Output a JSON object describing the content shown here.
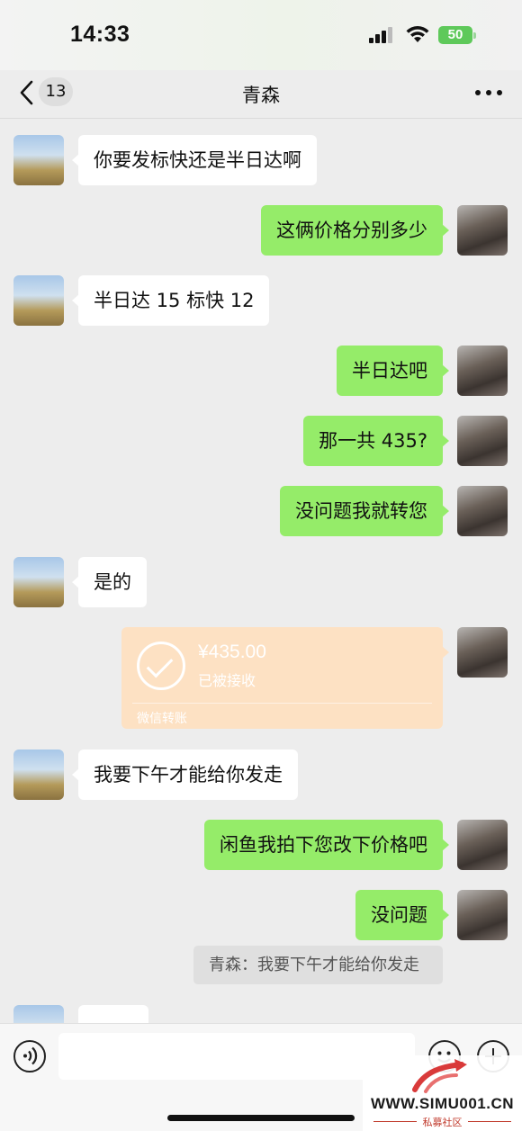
{
  "status_bar": {
    "time": "14:33",
    "battery": "50"
  },
  "nav": {
    "back_count": "13",
    "title": "青森"
  },
  "messages": [
    {
      "side": "in",
      "text": "你要发标快还是半日达啊"
    },
    {
      "side": "out",
      "text": "这俩价格分别多少"
    },
    {
      "side": "in",
      "text": "半日达 15 标快 12"
    },
    {
      "side": "out",
      "text": "半日达吧"
    },
    {
      "side": "out",
      "text": "那一共 435?"
    },
    {
      "side": "out",
      "text": "没问题我就转您"
    },
    {
      "side": "in",
      "text": "是的"
    },
    {
      "side": "in",
      "text": "我要下午才能给你发走"
    },
    {
      "side": "out",
      "text": "闲鱼我拍下您改下价格吧"
    },
    {
      "side": "out",
      "text": "没问题"
    }
  ],
  "transfer": {
    "amount": "¥435.00",
    "status": "已被接收",
    "label": "微信转账"
  },
  "quote": {
    "text": "青森：我要下午才能给你发走"
  },
  "input": {
    "placeholder": ""
  },
  "watermark": {
    "url": "WWW.SIMU001.CN",
    "sub": "私募社区"
  },
  "colors": {
    "outgoing_bubble": "#95ec69",
    "incoming_bubble": "#ffffff",
    "transfer_card": "#fde1c3",
    "background": "#ededed"
  }
}
